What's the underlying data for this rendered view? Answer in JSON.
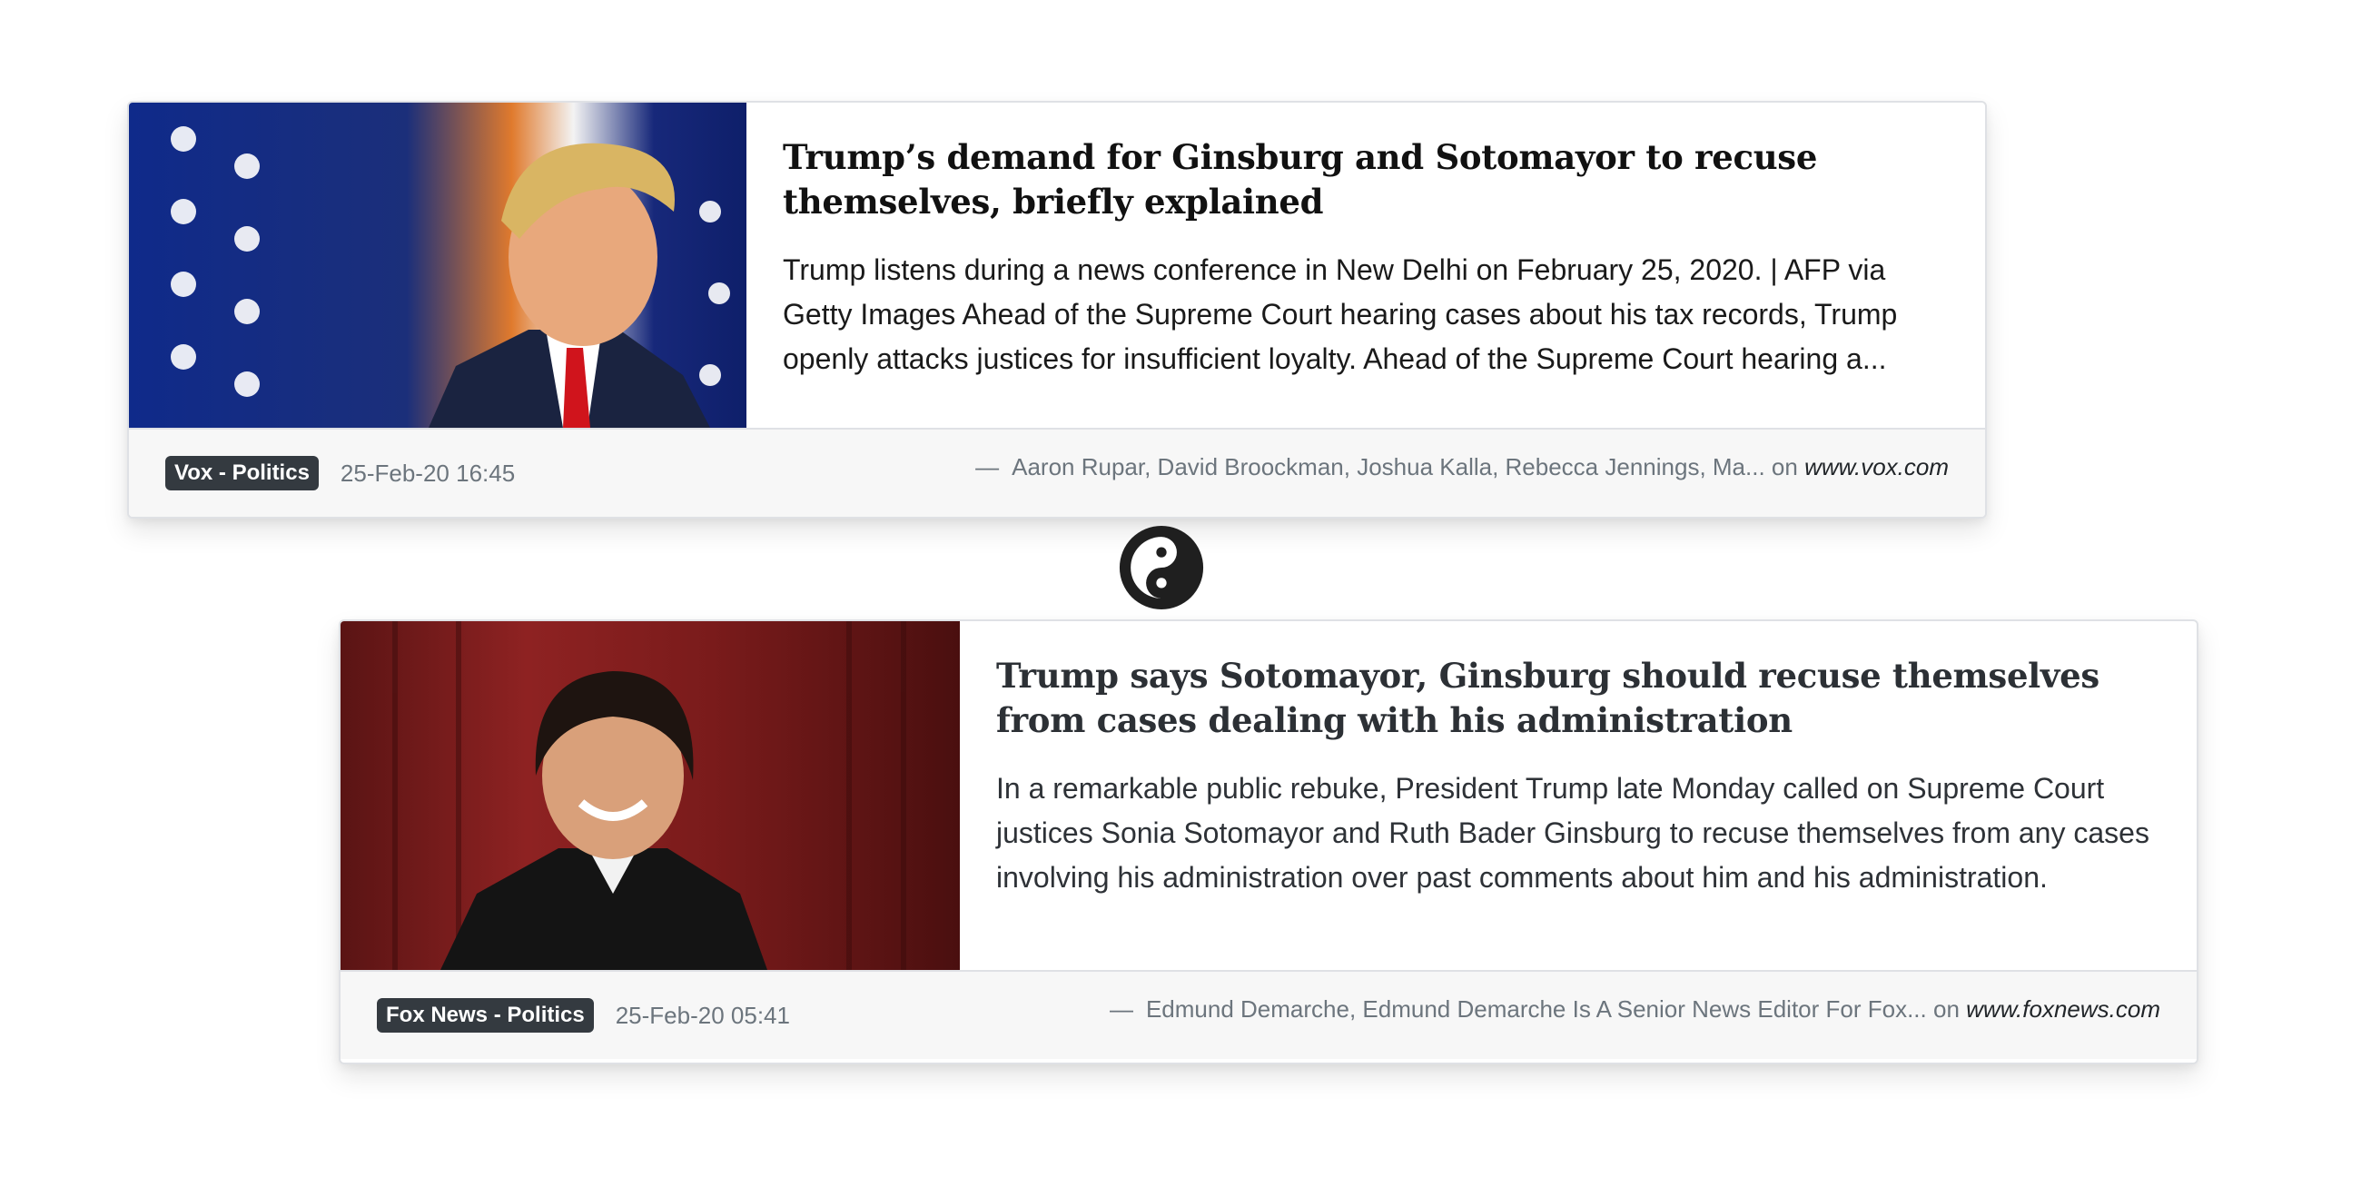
{
  "articles": [
    {
      "headline": "Trump’s demand for Ginsburg and Sotomayor to recuse themselves, briefly explained",
      "summary": "Trump listens during a news conference in New Delhi on February 25, 2020. | AFP via Getty Images Ahead of the Supreme Court hearing cases about his tax records, Trump openly attacks justices for insufficient loyalty. Ahead of the Supreme Court hearing a...",
      "source": "Vox - Politics",
      "date": "25-Feb-20 16:45",
      "dash": "—",
      "authors": "Aaron Rupar, David Broockman, Joshua Kalla, Rebecca Jennings, Ma...",
      "on": "on",
      "site": "www.vox.com"
    },
    {
      "headline": "Trump says Sotomayor, Ginsburg should recuse themselves from cases dealing with his administration",
      "summary": "In a remarkable public rebuke, President Trump late Monday called on Supreme Court justices Sonia Sotomayor and Ruth Bader Ginsburg to recuse themselves from any cases involving his administration over past comments about him and his administration.",
      "source": "Fox News - Politics",
      "date": "25-Feb-20 05:41",
      "dash": "—",
      "authors": "Edmund Demarche, Edmund Demarche Is A Senior News Editor For Fox...",
      "on": "on",
      "site": "www.foxnews.com"
    }
  ],
  "divider_icon": "yin-yang-icon",
  "colors": {
    "badge_bg": "#343a40",
    "footer_bg": "#f7f7f7",
    "muted_text": "#6c757d"
  }
}
